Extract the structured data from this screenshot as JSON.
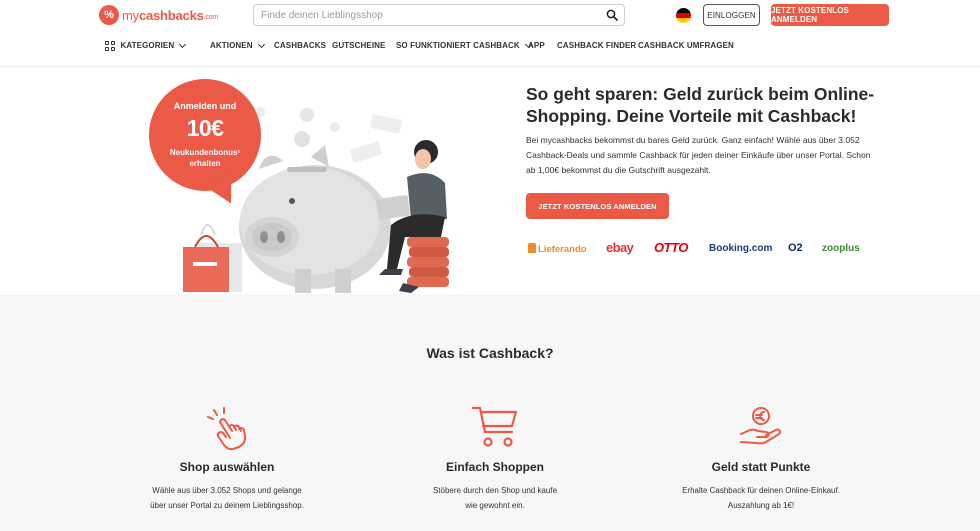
{
  "header": {
    "logo_mark": "%",
    "logo_text_my": "my",
    "logo_text_main": "cashbacks",
    "logo_text_tld": ".com",
    "search_placeholder": "Finde deinen Lieblingsshop",
    "login_label": "EINLOGGEN",
    "register_label": "JETZT KOSTENLOS ANMELDEN",
    "flag_country": "Germany"
  },
  "nav": {
    "items": [
      {
        "label": "KATEGORIEN",
        "dropdown": true,
        "icon": "grid-icon"
      },
      {
        "label": "AKTIONEN",
        "dropdown": true
      },
      {
        "label": "CASHBACKS",
        "dropdown": false
      },
      {
        "label": "GUTSCHEINE",
        "dropdown": false
      },
      {
        "label": "SO FUNKTIONIERT CASHBACK",
        "dropdown": true
      },
      {
        "label": "APP",
        "dropdown": false
      },
      {
        "label": "CASHBACK FINDER",
        "dropdown": false
      },
      {
        "label": "CASHBACK UMFRAGEN",
        "dropdown": false
      }
    ]
  },
  "hero": {
    "bubble_line1": "Anmelden und",
    "bubble_amount": "10€",
    "bubble_line3": "Neukundenbonus¹",
    "bubble_line4": "erhalten",
    "title": "So geht sparen: Geld zurück beim Online-Shopping. Deine Vorteile mit Cashback!",
    "text": "Bei mycashbacks bekommst du bares Geld zurück. Ganz einfach! Wähle aus über 3.052 Cashback-Deals und sammle Cashback für jeden deiner Einkäufe über unser Portal. Schon ab 1,00€ bekommst du die Gutschrift ausgezahlt.",
    "cta_label": "JETZT KOSTENLOS ANMELDEN",
    "partners": [
      "Lieferando",
      "ebay",
      "OTTO",
      "Booking.com",
      "O2",
      "zooplus"
    ]
  },
  "section": {
    "title": "Was ist Cashback?",
    "features": [
      {
        "icon": "hand-pointer-icon",
        "title": "Shop auswählen",
        "line1": "Wähle aus über 3.052 Shops und gelange",
        "line2": "über unser Portal zu deinem Lieblingsshop."
      },
      {
        "icon": "shopping-cart-icon",
        "title": "Einfach Shoppen",
        "line1": "Stöbere durch den Shop und kaufe",
        "line2": "wie gewohnt ein."
      },
      {
        "icon": "euro-hand-icon",
        "title": "Geld statt Punkte",
        "line1": "Erhalte Cashback für deinen Online-Einkauf.",
        "line2": "Auszahlung ab 1€!"
      }
    ]
  },
  "colors": {
    "brand": "#ea5a47",
    "text": "#2b2b2b",
    "section_bg": "#f7f7f7"
  }
}
